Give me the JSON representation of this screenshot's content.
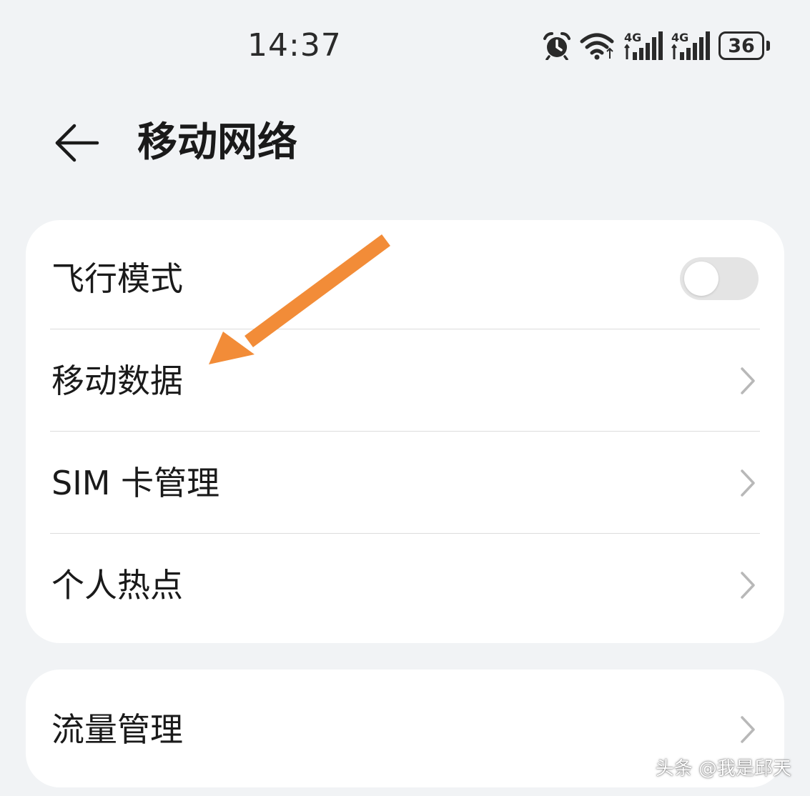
{
  "status_bar": {
    "time": "14:37",
    "icons": [
      "alarm-icon",
      "wifi-icon",
      "signal-4g-icon",
      "signal-4g-icon"
    ],
    "network_type_1": "4G",
    "network_type_2": "4G",
    "battery_level": "36"
  },
  "header": {
    "back_icon": "arrow-left-icon",
    "title": "移动网络"
  },
  "settings": {
    "items": [
      {
        "label": "飞行模式",
        "control": "toggle",
        "toggle_on": false
      },
      {
        "label": "移动数据",
        "control": "chevron"
      },
      {
        "label": "SIM 卡管理",
        "control": "chevron"
      },
      {
        "label": "个人热点",
        "control": "chevron"
      }
    ],
    "data_items": [
      {
        "label": "流量管理",
        "control": "chevron"
      }
    ]
  },
  "annotation": {
    "type": "arrow",
    "color": "#f28c38",
    "points_to": "移动数据"
  },
  "watermark": "头条 @我是邱天",
  "colors": {
    "background": "#f1f3f5",
    "card": "#ffffff",
    "toggle_off": "#e4e4e4",
    "divider": "#dcdcdc",
    "chevron": "#b8b8b8",
    "arrow": "#f28c38"
  }
}
